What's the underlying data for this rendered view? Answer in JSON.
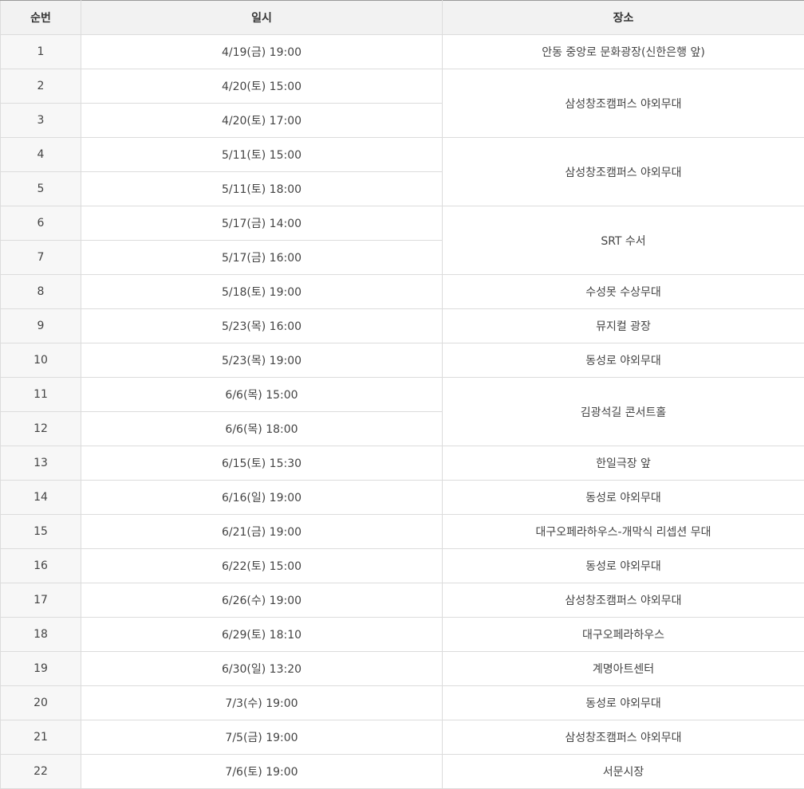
{
  "table": {
    "headers": [
      "순번",
      "일시",
      "장소"
    ],
    "rows": [
      {
        "no": "1",
        "date": "4/19(금) 19:00",
        "place": "안동 중앙로 문화광장(신한은행 앞)",
        "span": 1
      },
      {
        "no": "2",
        "date": "4/20(토) 15:00",
        "place": "삼성창조캠퍼스 야외무대",
        "span": 2
      },
      {
        "no": "3",
        "date": "4/20(토) 17:00",
        "place": null,
        "span": 0
      },
      {
        "no": "4",
        "date": "5/11(토) 15:00",
        "place": "삼성창조캠퍼스 야외무대",
        "span": 2
      },
      {
        "no": "5",
        "date": "5/11(토) 18:00",
        "place": null,
        "span": 0
      },
      {
        "no": "6",
        "date": "5/17(금) 14:00",
        "place": "SRT 수서",
        "span": 2
      },
      {
        "no": "7",
        "date": "5/17(금) 16:00",
        "place": null,
        "span": 0
      },
      {
        "no": "8",
        "date": "5/18(토) 19:00",
        "place": "수성못 수상무대",
        "span": 1
      },
      {
        "no": "9",
        "date": "5/23(목) 16:00",
        "place": "뮤지컬 광장",
        "span": 1
      },
      {
        "no": "10",
        "date": "5/23(목) 19:00",
        "place": "동성로 야외무대",
        "span": 1
      },
      {
        "no": "11",
        "date": "6/6(목) 15:00",
        "place": "김광석길 콘서트홀",
        "span": 2
      },
      {
        "no": "12",
        "date": "6/6(목) 18:00",
        "place": null,
        "span": 0
      },
      {
        "no": "13",
        "date": "6/15(토) 15:30",
        "place": "한일극장 앞",
        "span": 1
      },
      {
        "no": "14",
        "date": "6/16(일) 19:00",
        "place": "동성로 야외무대",
        "span": 1
      },
      {
        "no": "15",
        "date": "6/21(금) 19:00",
        "place": "대구오페라하우스-개막식 리셉션 무대",
        "span": 1
      },
      {
        "no": "16",
        "date": "6/22(토) 15:00",
        "place": "동성로 야외무대",
        "span": 1
      },
      {
        "no": "17",
        "date": "6/26(수) 19:00",
        "place": "삼성창조캠퍼스 야외무대",
        "span": 1
      },
      {
        "no": "18",
        "date": "6/29(토) 18:10",
        "place": "대구오페라하우스",
        "span": 1
      },
      {
        "no": "19",
        "date": "6/30(일) 13:20",
        "place": "계명아트센터",
        "span": 1
      },
      {
        "no": "20",
        "date": "7/3(수) 19:00",
        "place": "동성로 야외무대",
        "span": 1
      },
      {
        "no": "21",
        "date": "7/5(금) 19:00",
        "place": "삼성창조캠퍼스 야외무대",
        "span": 1
      },
      {
        "no": "22",
        "date": "7/6(토) 19:00",
        "place": "서문시장",
        "span": 1
      }
    ]
  },
  "colors": {
    "header_bg": "#f2f2f2",
    "num_bg": "#f7f7f7",
    "border": "#dcdcdc",
    "text": "#444444"
  }
}
